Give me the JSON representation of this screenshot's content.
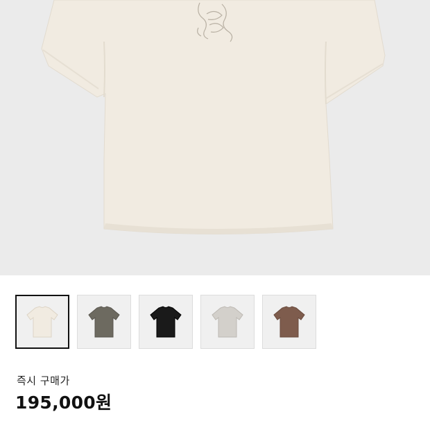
{
  "product": {
    "main_image_icon": "tshirt-icon",
    "main_color": "#f1ebe1",
    "thumbnails": [
      {
        "name": "thumbnail-cream",
        "color": "#f1ebe1",
        "stroke": "#ddd4c6",
        "selected": true
      },
      {
        "name": "thumbnail-olive-gray",
        "color": "#6d6a60",
        "stroke": "#5a574f",
        "selected": false
      },
      {
        "name": "thumbnail-black",
        "color": "#1a1a1a",
        "stroke": "#000000",
        "selected": false
      },
      {
        "name": "thumbnail-light-gray",
        "color": "#d3d0cb",
        "stroke": "#bdb9b3",
        "selected": false
      },
      {
        "name": "thumbnail-brown",
        "color": "#7e5c4d",
        "stroke": "#6a4b3e",
        "selected": false
      }
    ]
  },
  "purchase": {
    "label": "즉시 구매가",
    "price": "195,000원"
  }
}
